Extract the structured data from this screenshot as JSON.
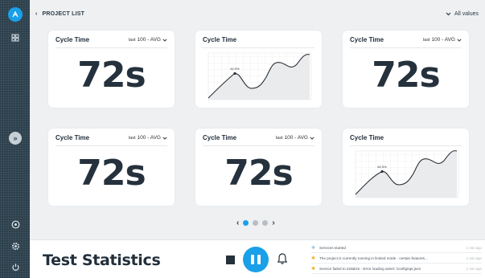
{
  "nav": {
    "back_label": "PROJECT LIST",
    "values_label": "All values"
  },
  "cards": [
    {
      "title": "Cycle Time",
      "agg_prefix": "last",
      "agg_value": "100 - AVG",
      "kind": "value",
      "value": "72s"
    },
    {
      "title": "Cycle Time",
      "kind": "chart",
      "peak_label": "62,9%"
    },
    {
      "title": "Cycle Time",
      "agg_prefix": "last",
      "agg_value": "100 - AVG",
      "kind": "value",
      "value": "72s"
    },
    {
      "title": "Cycle Time",
      "agg_prefix": "last",
      "agg_value": "100 - AVG",
      "kind": "value",
      "value": "72s"
    },
    {
      "title": "Cycle Time",
      "agg_prefix": "last",
      "agg_value": "100 - AVG",
      "kind": "value",
      "value": "72s"
    },
    {
      "title": "Cycle Time",
      "kind": "chart",
      "peak_label": "62,0%"
    }
  ],
  "pager": {
    "pages": 3,
    "current": 1
  },
  "bottom": {
    "title": "Test Statistics",
    "log": [
      {
        "level": "info",
        "message": "Services started",
        "time": "1 min ago"
      },
      {
        "level": "warning",
        "message": "The project is currently running in limited mode - certain features...",
        "time": "1 min ago"
      },
      {
        "level": "warning",
        "message": "Service failed to initialize - Error loading asset: /config/api.json",
        "time": "1 min ago"
      }
    ]
  },
  "colors": {
    "accent": "#1aa0e8",
    "sidebar": "#2b3f4c",
    "warning": "#f2b21b",
    "info": "#8fc9ec"
  }
}
